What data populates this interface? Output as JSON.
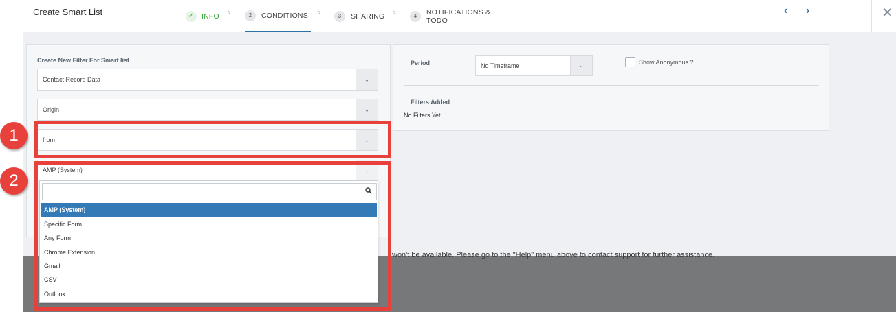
{
  "header": {
    "title": "Create Smart List",
    "steps": [
      {
        "num": "",
        "label": "INFO"
      },
      {
        "num": "2",
        "label": "CONDITIONS"
      },
      {
        "num": "3",
        "label": "SHARING"
      },
      {
        "num": "4",
        "label_line1": "NOTIFICATIONS &",
        "label_line2": "TODO"
      }
    ],
    "prev_icon": "chevron-left-icon",
    "next_icon": "chevron-right-icon",
    "close_icon": "close-icon"
  },
  "filter": {
    "heading": "Create New Filter For Smart list",
    "select1": "Contact Record Data",
    "select2": "Origin",
    "select3": "from",
    "select4": "AMP (System)"
  },
  "dropdown": {
    "search_placeholder": "",
    "options": [
      "AMP (System)",
      "Specific Form",
      "Any Form",
      "Chrome Extension",
      "Gmail",
      "CSV",
      "Outlook"
    ],
    "selected": "AMP (System)"
  },
  "right": {
    "period_label": "Period",
    "period_value": "No Timeframe",
    "show_anonymous": "Show Anonymous ?",
    "filters_added_label": "Filters Added",
    "filters_empty": "No Filters Yet"
  },
  "overlay_text": "won't be available. Please go to the \"Help\" menu above to contact support for further assistance.",
  "callouts": [
    "1",
    "2"
  ],
  "colors": {
    "accent": "#2f6fa8",
    "success": "#3aa63a",
    "selected": "#337ab7",
    "callout": "#e8413c"
  }
}
